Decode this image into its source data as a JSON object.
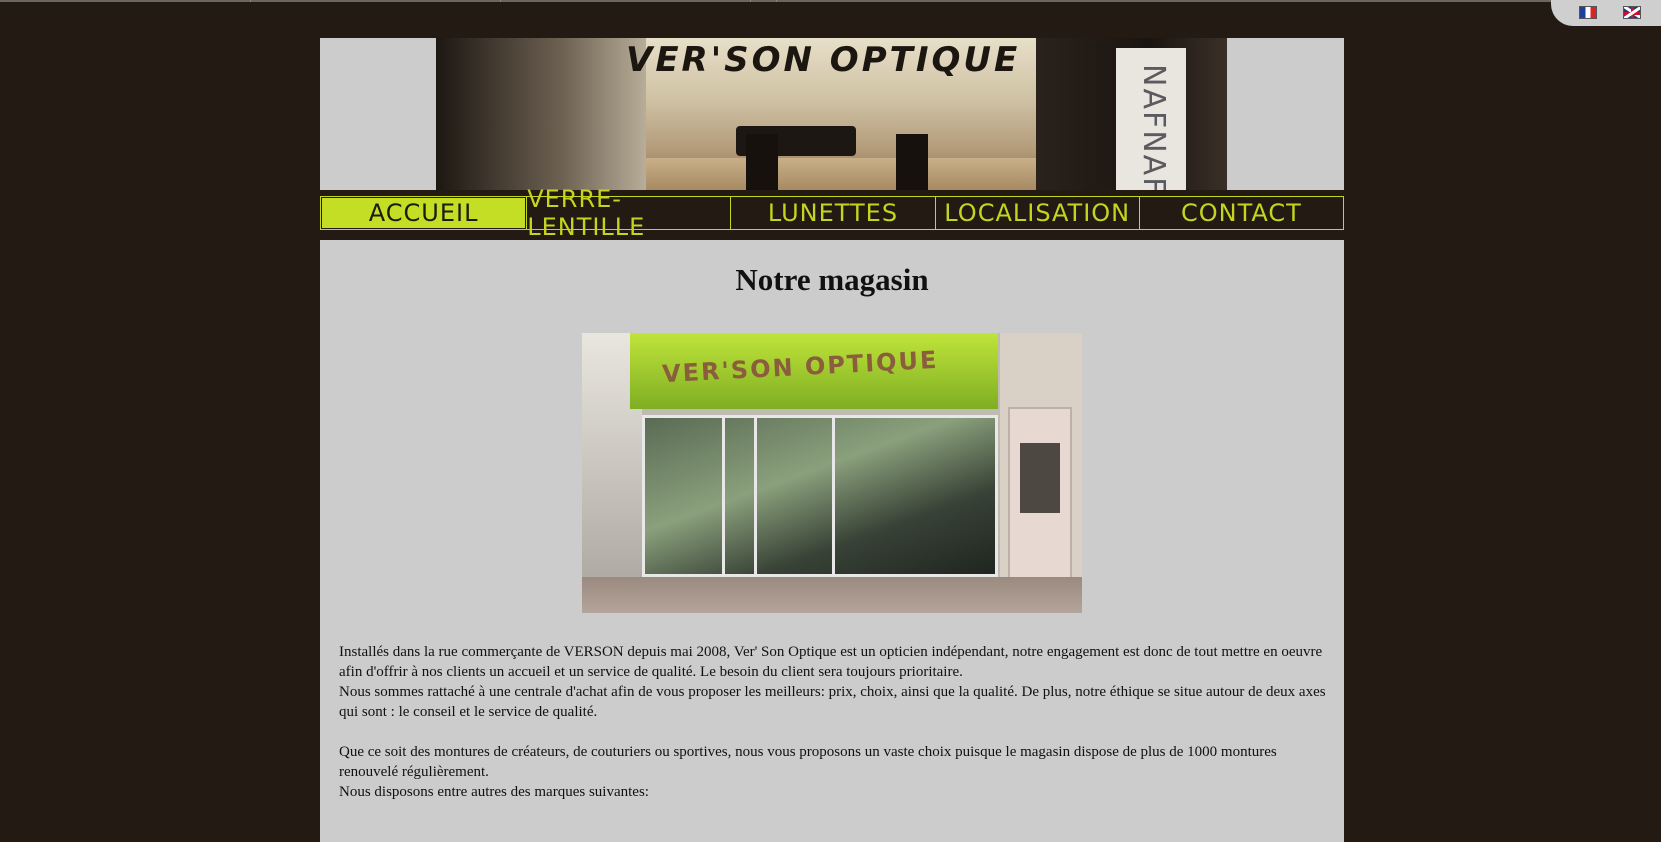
{
  "header": {
    "banner_title": "VER'SON OPTIQUE",
    "banner_brand": "NAFNAF"
  },
  "languages": [
    {
      "name": "Français",
      "icon": "french-flag-icon"
    },
    {
      "name": "English",
      "icon": "english-flag-icon"
    }
  ],
  "nav": {
    "items": [
      {
        "label": "ACCUEIL",
        "active": true
      },
      {
        "label": "VERRE-LENTILLE",
        "active": false
      },
      {
        "label": "LUNETTES",
        "active": false
      },
      {
        "label": "LOCALISATION",
        "active": false
      },
      {
        "label": "CONTACT",
        "active": false
      }
    ]
  },
  "main": {
    "title": "Notre magasin",
    "storefront_sign": "VER'SON OPTIQUE",
    "paragraphs": [
      "Installés dans la rue commerçante de VERSON depuis mai 2008, Ver' Son Optique est un opticien indépendant, notre engagement est donc de tout mettre en oeuvre afin d'offrir à nos clients un accueil et un service de qualité. Le besoin du client sera toujours prioritaire.",
      "Nous sommes rattaché à une centrale d'achat afin de vous proposer les meilleurs: prix, choix, ainsi que la qualité. De plus, notre éthique se situe autour de deux axes qui sont : le conseil et le service de qualité.",
      "Que ce soit des montures de créateurs, de couturiers ou sportives, nous vous proposons un vaste choix puisque le magasin dispose de plus de 1000 montures renouvelé régulièrement.",
      "Nous disposons entre autres des marques suivantes:"
    ]
  },
  "colors": {
    "background": "#221a13",
    "panel": "#cccccc",
    "accent": "#c6d420"
  }
}
